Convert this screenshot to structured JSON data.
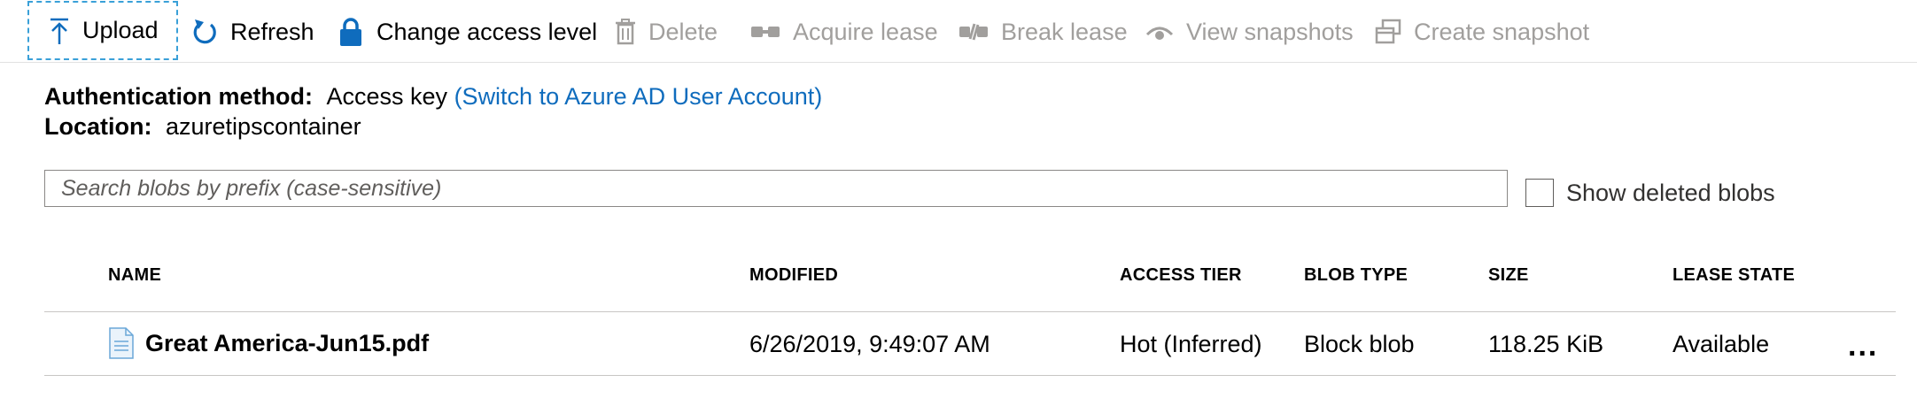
{
  "toolbar": {
    "upload": "Upload",
    "refresh": "Refresh",
    "change_access": "Change access level",
    "delete": "Delete",
    "acquire_lease": "Acquire lease",
    "break_lease": "Break lease",
    "view_snapshots": "View snapshots",
    "create_snapshot": "Create snapshot"
  },
  "info": {
    "auth_label": "Authentication method:",
    "auth_value": "Access key",
    "auth_link": "(Switch to Azure AD User Account)",
    "location_label": "Location:",
    "location_value": "azuretipscontainer"
  },
  "search": {
    "placeholder": "Search blobs by prefix (case-sensitive)"
  },
  "show_deleted": {
    "label": "Show deleted blobs",
    "checked": false
  },
  "table": {
    "headers": {
      "name": "NAME",
      "modified": "MODIFIED",
      "access_tier": "ACCESS TIER",
      "blob_type": "BLOB TYPE",
      "size": "SIZE",
      "lease_state": "LEASE STATE"
    },
    "rows": [
      {
        "name": "Great America-Jun15.pdf",
        "modified": "6/26/2019, 9:49:07 AM",
        "access_tier": "Hot (Inferred)",
        "blob_type": "Block blob",
        "size": "118.25 KiB",
        "lease_state": "Available",
        "more": "..."
      }
    ]
  },
  "icons": {
    "upload": "upload-arrow-icon",
    "refresh": "refresh-icon",
    "change_access": "lock-icon",
    "delete": "trash-icon",
    "acquire_lease": "link-icon",
    "break_lease": "broken-link-icon",
    "view_snapshots": "eye-icon",
    "create_snapshot": "snapshot-icon",
    "file": "document-icon"
  },
  "colors": {
    "link": "#0f6cbd",
    "accent": "#0f6cbd",
    "disabled": "#a19f9d",
    "focus_border": "#3aa0d8"
  }
}
